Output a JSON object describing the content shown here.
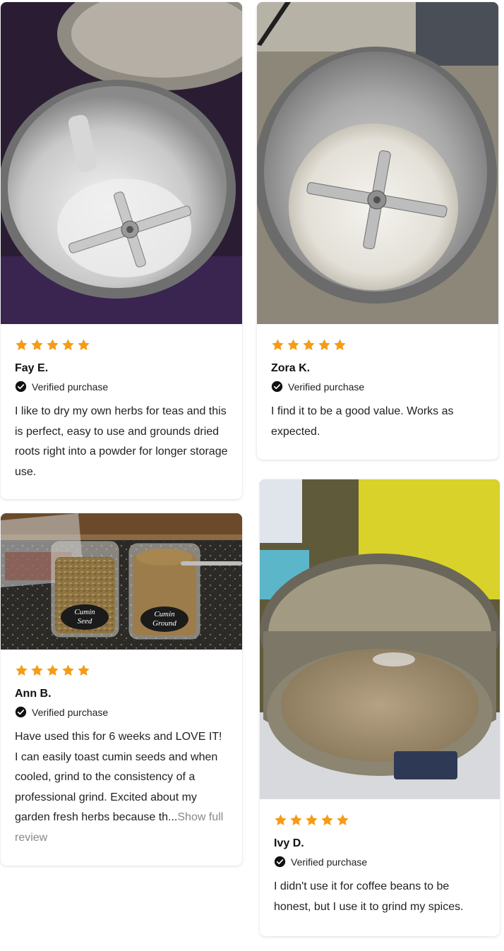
{
  "colors": {
    "star": "#f59b14",
    "text": "#222222",
    "muted": "#888888"
  },
  "icons": {
    "star": "star-icon",
    "verified": "check-circle-icon"
  },
  "reviews": [
    {
      "rating": 5,
      "name": "Fay E.",
      "verified": "Verified purchase",
      "text": "I like to dry my own herbs for teas and this is perfect, easy to use and grounds dried roots right into a powder for longer storage use.",
      "more": ""
    },
    {
      "rating": 5,
      "name": "Zora K.",
      "verified": "Verified purchase",
      "text": "I find it to be a good value. Works as expected.",
      "more": ""
    },
    {
      "rating": 5,
      "name": "Ann B.",
      "verified": "Verified purchase",
      "text": "Have used this for 6 weeks and LOVE IT! I can easily toast cumin seeds and when cooled, grind to the consistency of a professional grind. Excited about my garden fresh herbs because th...",
      "more": "Show full review"
    },
    {
      "rating": 5,
      "name": "Ivy D.",
      "verified": "Verified purchase",
      "text": "I didn't use it for coffee beans to be honest, but I use it to grind my spices.",
      "more": ""
    }
  ],
  "jar_labels": [
    {
      "line1": "Cumin",
      "line2": "Seed"
    },
    {
      "line1": "Cumin",
      "line2": "Ground"
    }
  ]
}
